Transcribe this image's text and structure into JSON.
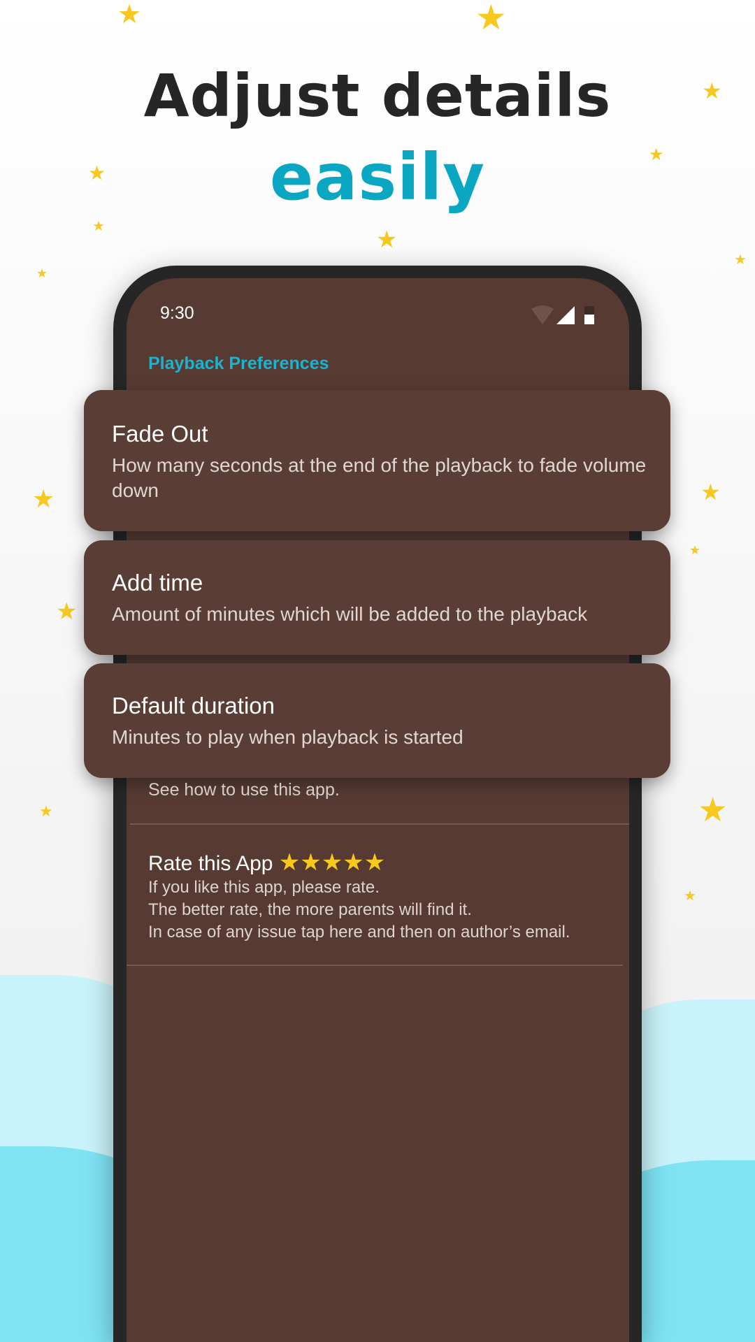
{
  "headline": {
    "line1": "Adjust details",
    "line2": "easily"
  },
  "colors": {
    "accent": "#0aa6c2",
    "screen_bg": "#573b33",
    "card_bg": "#5a3d34",
    "star": "#f7c81e"
  },
  "status_bar": {
    "time": "9:30",
    "icons": [
      "wifi-icon",
      "signal-icon",
      "battery-icon"
    ]
  },
  "section": {
    "title": "Playback Preferences"
  },
  "cards": [
    {
      "title": "Fade Out",
      "subtitle": "How many seconds at the end of the playback to fade volume down"
    },
    {
      "title": "Add time",
      "subtitle": "Amount of minutes which will be added to the playback"
    },
    {
      "title": "Default duration",
      "subtitle": "Minutes to play when playback is started"
    }
  ],
  "help": {
    "subtitle": "See how to use this app."
  },
  "rate": {
    "title": "Rate this App",
    "stars": "★★★★★",
    "lines": [
      "If you like this app, please rate.",
      "The better rate, the more parents will find it.",
      "In case of any issue tap here and then on author’s email."
    ]
  }
}
